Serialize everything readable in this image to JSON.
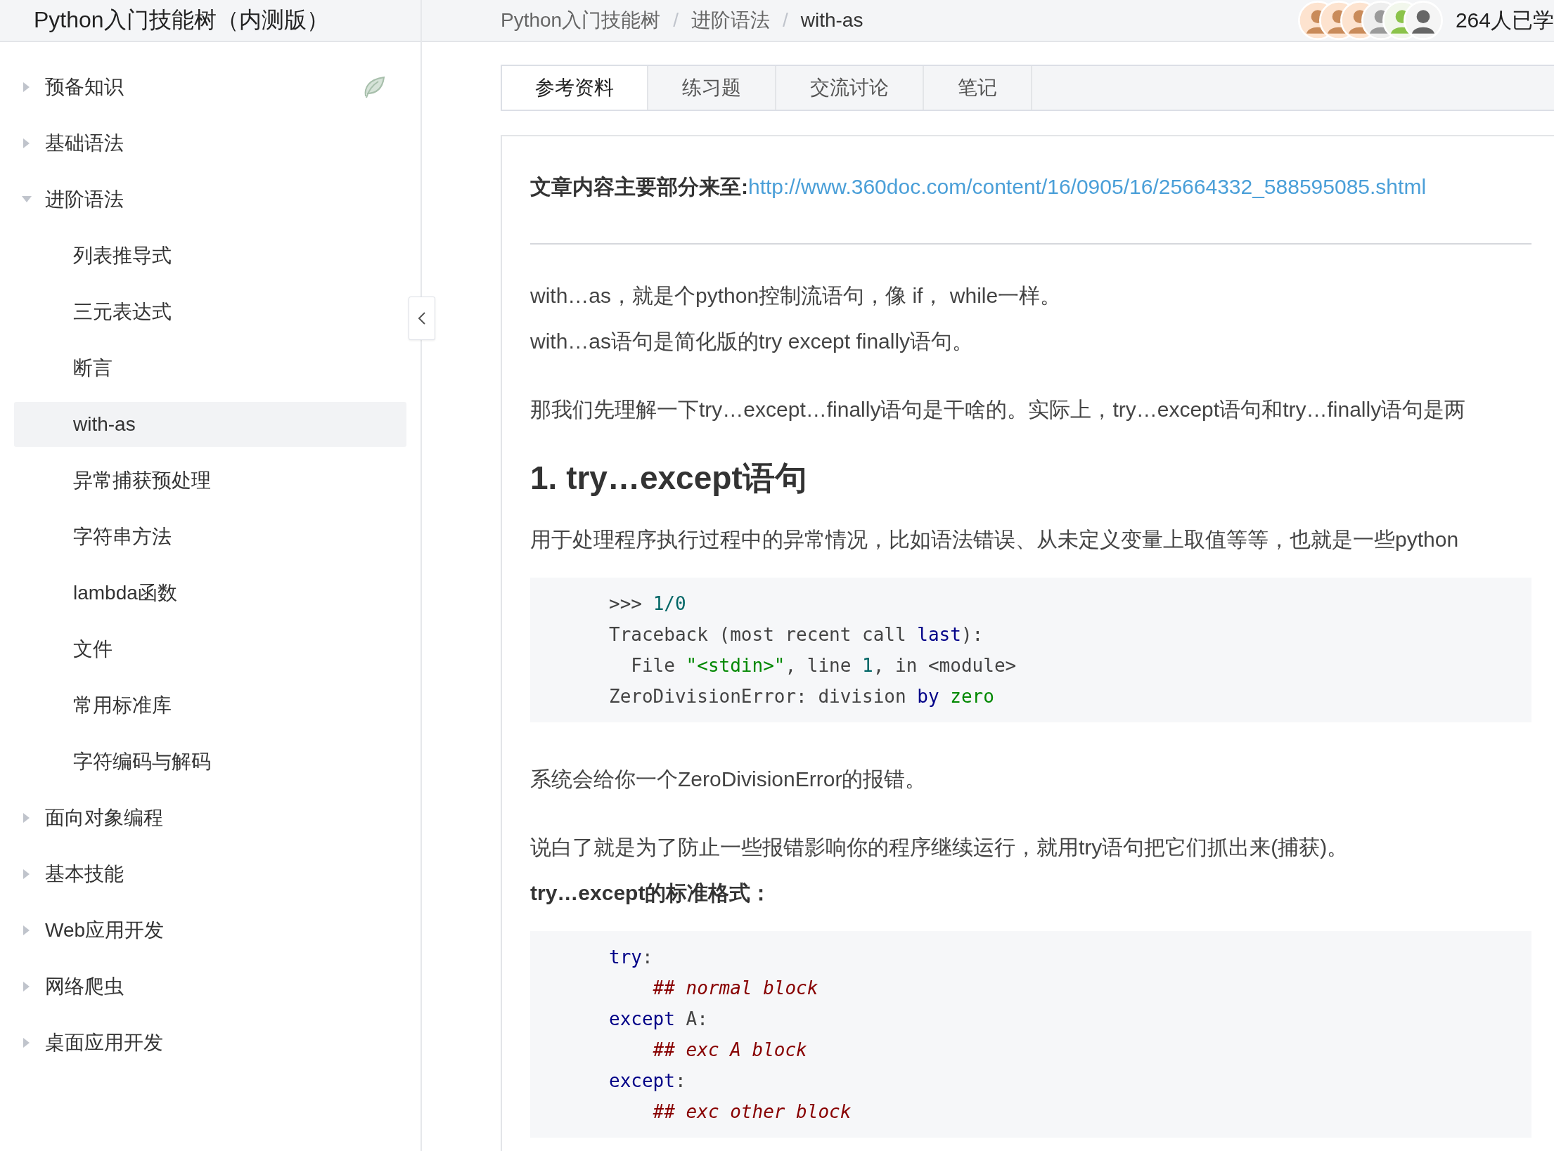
{
  "app": {
    "title": "Python入门技能树（内测版）"
  },
  "sidebar": {
    "items": [
      {
        "label": "预备知识",
        "expanded": false,
        "marked": true
      },
      {
        "label": "基础语法",
        "expanded": false,
        "marked": false
      },
      {
        "label": "进阶语法",
        "expanded": true,
        "marked": false,
        "children": [
          {
            "label": "列表推导式",
            "selected": false
          },
          {
            "label": "三元表达式",
            "selected": false
          },
          {
            "label": "断言",
            "selected": false
          },
          {
            "label": "with-as",
            "selected": true
          },
          {
            "label": "异常捕获预处理",
            "selected": false
          },
          {
            "label": "字符串方法",
            "selected": false
          },
          {
            "label": "lambda函数",
            "selected": false
          },
          {
            "label": "文件",
            "selected": false
          },
          {
            "label": "常用标准库",
            "selected": false
          },
          {
            "label": "字符编码与解码",
            "selected": false
          }
        ]
      },
      {
        "label": "面向对象编程",
        "expanded": false,
        "marked": false
      },
      {
        "label": "基本技能",
        "expanded": false,
        "marked": false
      },
      {
        "label": "Web应用开发",
        "expanded": false,
        "marked": false
      },
      {
        "label": "网络爬虫",
        "expanded": false,
        "marked": false
      },
      {
        "label": "桌面应用开发",
        "expanded": false,
        "marked": false
      }
    ]
  },
  "breadcrumb": {
    "separator": "/",
    "items": [
      "Python入门技能树",
      "进阶语法",
      "with-as"
    ]
  },
  "learners": {
    "count": "264人已学"
  },
  "tabs": [
    {
      "label": "参考资料",
      "selected": true
    },
    {
      "label": "练习题",
      "selected": false
    },
    {
      "label": "交流讨论",
      "selected": false
    },
    {
      "label": "笔记",
      "selected": false
    }
  ],
  "article": [
    {
      "kind": "source",
      "label": "文章内容主要部分来至:",
      "link": "http://www.360doc.com/content/16/0905/16/25664332_588595085.shtml"
    },
    {
      "kind": "rule"
    },
    {
      "kind": "paragraph",
      "lines": [
        {
          "text": "with…as，就是个python控制流语句，像 if， while一样。",
          "bold": false
        },
        {
          "text": "with…as语句是简化版的try except finally语句。",
          "bold": false
        }
      ]
    },
    {
      "kind": "paragraph",
      "lines": [
        {
          "text": "那我们先理解一下try…except…finally语句是干啥的。实际上，try…except语句和try…finally语句是两",
          "bold": false
        }
      ]
    },
    {
      "kind": "heading",
      "text": "1. try…except语句"
    },
    {
      "kind": "paragraph",
      "lines": [
        {
          "text": "用于处理程序执行过程中的异常情况，比如语法错误、从未定义变量上取值等等，也就是一些python",
          "bold": false
        }
      ]
    },
    {
      "kind": "code",
      "lines": [
        [
          {
            "text": ">>> ",
            "kind": "plain"
          },
          {
            "text": "1/0",
            "kind": "number"
          }
        ],
        [
          {
            "text": "Traceback (most recent call ",
            "kind": "plain"
          },
          {
            "text": "last",
            "kind": "keyword"
          },
          {
            "text": "):",
            "kind": "plain"
          }
        ],
        [
          {
            "text": "  File ",
            "kind": "plain"
          },
          {
            "text": "\"<stdin>\"",
            "kind": "string"
          },
          {
            "text": ", line ",
            "kind": "plain"
          },
          {
            "text": "1",
            "kind": "number"
          },
          {
            "text": ", in <module>",
            "kind": "plain"
          }
        ],
        [
          {
            "text": "ZeroDivisionError: division ",
            "kind": "plain"
          },
          {
            "text": "by ",
            "kind": "keyword"
          },
          {
            "text": "zero",
            "kind": "string"
          }
        ]
      ]
    },
    {
      "kind": "paragraph",
      "lines": [
        {
          "text": "系统会给你一个ZeroDivisionError的报错。",
          "bold": false
        }
      ]
    },
    {
      "kind": "paragraph",
      "lines": [
        {
          "text": "说白了就是为了防止一些报错影响你的程序继续运行，就用try语句把它们抓出来(捕获)。",
          "bold": false
        },
        {
          "text": "try…except的标准格式：",
          "bold": true
        }
      ]
    },
    {
      "kind": "code",
      "lines": [
        [
          {
            "text": "try",
            "kind": "keyword"
          },
          {
            "text": ":",
            "kind": "plain"
          }
        ],
        [
          {
            "text": "    ## normal block",
            "kind": "comment"
          }
        ],
        [
          {
            "text": "except",
            "kind": "keyword"
          },
          {
            "text": " A:",
            "kind": "plain"
          }
        ],
        [
          {
            "text": "    ## exc A block",
            "kind": "comment"
          }
        ],
        [
          {
            "text": "except",
            "kind": "keyword"
          },
          {
            "text": ":",
            "kind": "plain"
          }
        ],
        [
          {
            "text": "    ## exc other block",
            "kind": "comment"
          }
        ]
      ]
    }
  ]
}
